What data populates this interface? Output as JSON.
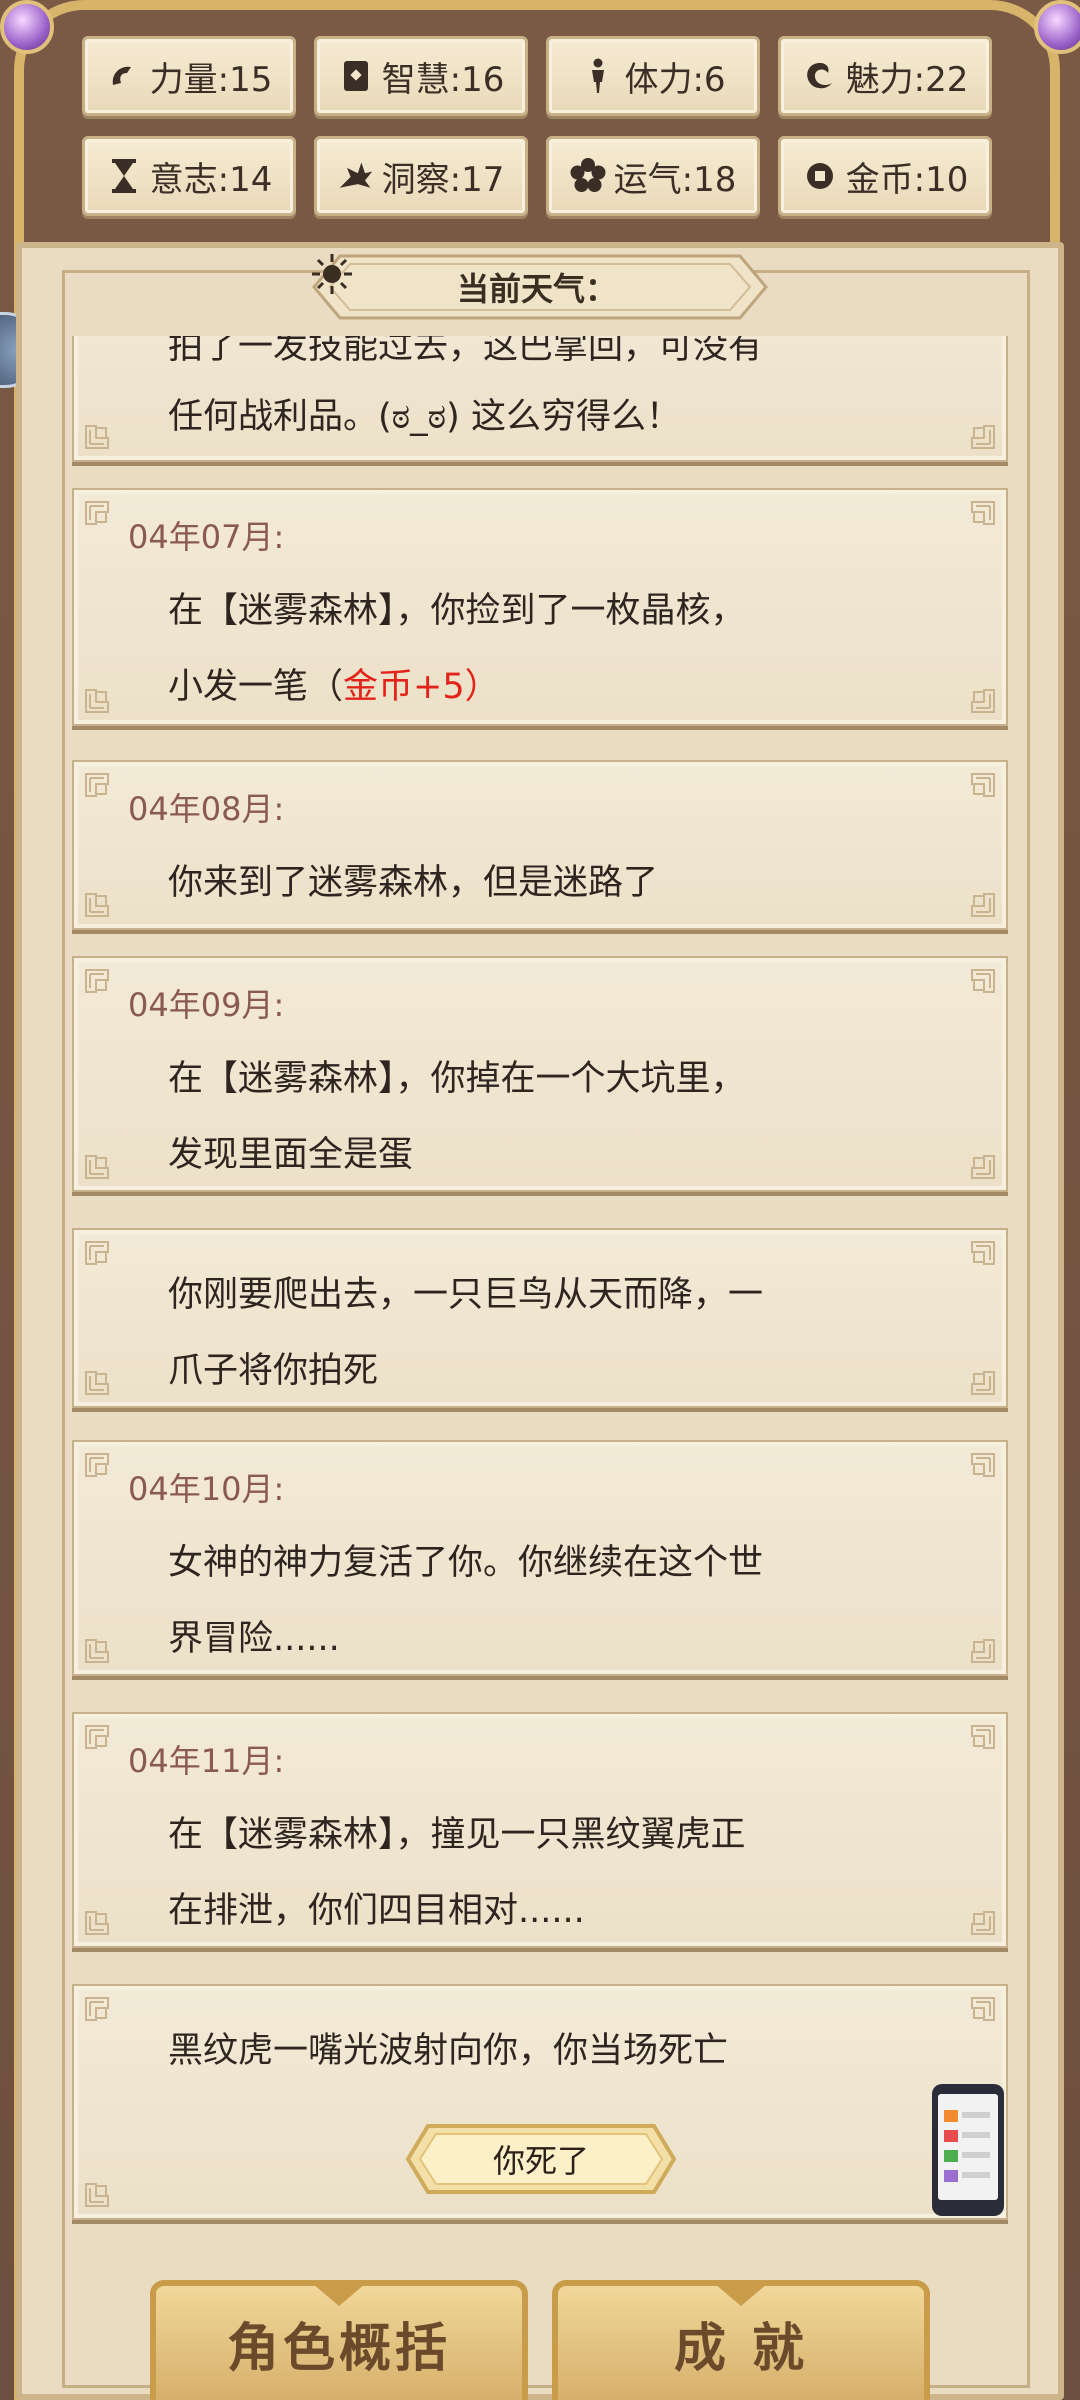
{
  "stats": [
    {
      "label": "力量:15",
      "icon": "arm-icon"
    },
    {
      "label": "智慧:16",
      "icon": "book-icon"
    },
    {
      "label": "体力:6",
      "icon": "person-icon"
    },
    {
      "label": "魅力:22",
      "icon": "swirl-icon"
    },
    {
      "label": "意志:14",
      "icon": "hourglass-icon"
    },
    {
      "label": "洞察:17",
      "icon": "wing-icon"
    },
    {
      "label": "运气:18",
      "icon": "flower-icon"
    },
    {
      "label": "金币:10",
      "icon": "coin-icon"
    }
  ],
  "weather": {
    "label": "当前天气：",
    "icon": "sun-icon"
  },
  "log": {
    "partial_top": {
      "line1": "拍了一发技能过去，这巴掌回，可没有",
      "line2": "任何战利品。(ಠ_ಠ) 这么穷得么！"
    },
    "entries": [
      {
        "date": "04年07月:",
        "line1": "在【迷雾森林】，你捡到了一枚晶核，",
        "line2_plain": "小发一笔（",
        "line2_red": "金币+5",
        "line2_end": "）"
      },
      {
        "date": "04年08月:",
        "line1": "你来到了迷雾森林，但是迷路了"
      },
      {
        "date": "04年09月:",
        "line1": "在【迷雾森林】，你掉在一个大坑里，",
        "line2": "发现里面全是蛋"
      },
      {
        "line1": "你刚要爬出去，一只巨鸟从天而降，一",
        "line2": "爪子将你拍死"
      },
      {
        "date": "04年10月:",
        "line1": "女神的神力复活了你。你继续在这个世",
        "line2": "界冒险......"
      },
      {
        "date": "04年11月:",
        "line1": "在【迷雾森林】，撞见一只黑纹翼虎正",
        "line2": "在排泄，你们四目相对......"
      },
      {
        "line1": "黑纹虎一嘴光波射向你，你当场死亡"
      }
    ],
    "dead_button": "你死了"
  },
  "tabs": {
    "summary": "角色概括",
    "achievements": "成 就"
  },
  "colors": {
    "accent_red": "#e3231a",
    "date": "#8a5a52",
    "gold": "#d8b46a"
  }
}
